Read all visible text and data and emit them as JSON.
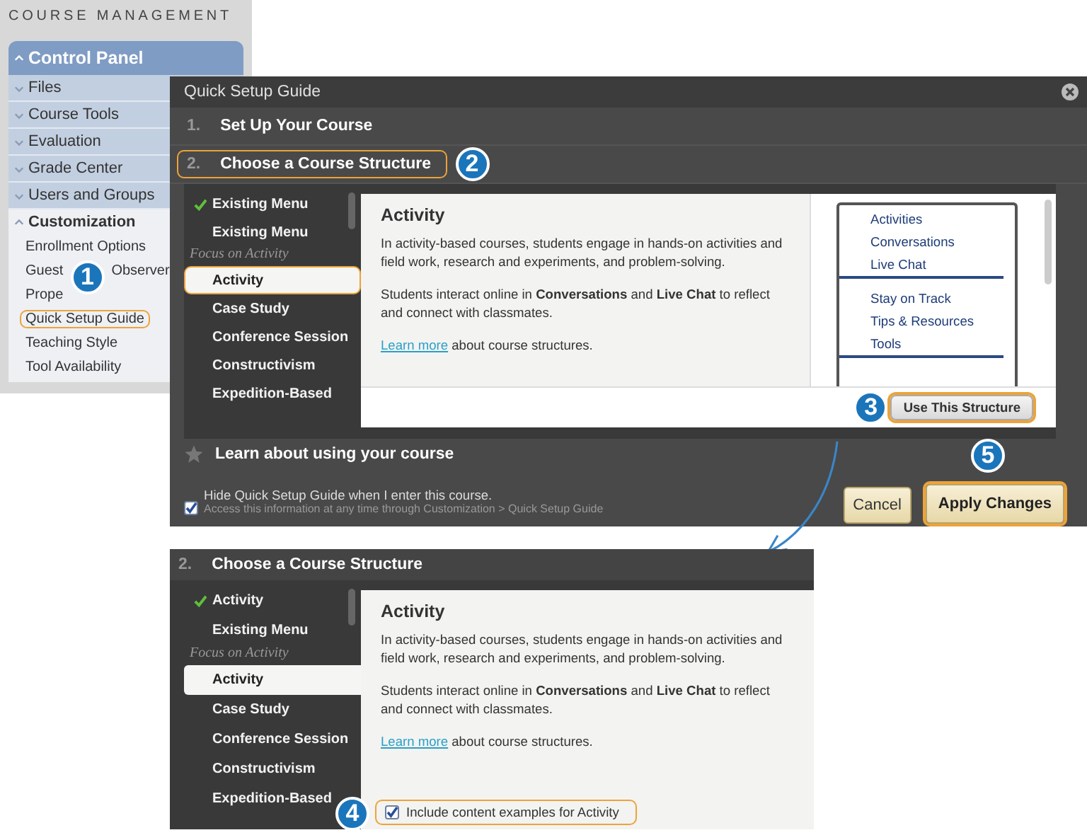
{
  "sidebar": {
    "heading": "COURSE MANAGEMENT",
    "panel_title": "Control Panel",
    "sections": [
      {
        "label": "Files",
        "expanded": false
      },
      {
        "label": "Course Tools",
        "expanded": false
      },
      {
        "label": "Evaluation",
        "expanded": false
      },
      {
        "label": "Grade Center",
        "expanded": false
      },
      {
        "label": "Users and Groups",
        "expanded": false
      },
      {
        "label": "Customization",
        "expanded": true,
        "items": [
          {
            "segments": [
              "Enrollment Options"
            ],
            "highlighted": false
          },
          {
            "segments": [
              "Guest",
              "Observer"
            ],
            "highlighted": false,
            "callout": "1"
          },
          {
            "segments": [
              "Prope"
            ],
            "highlighted": false
          },
          {
            "segments": [
              "Quick Setup Guide"
            ],
            "highlighted": true
          },
          {
            "segments": [
              "Teaching Style"
            ],
            "highlighted": false
          },
          {
            "segments": [
              "Tool Availability"
            ],
            "highlighted": false
          }
        ]
      }
    ]
  },
  "dialog": {
    "title": "Quick Setup Guide",
    "steps": [
      {
        "number": "1.",
        "label": "Set Up Your Course",
        "highlighted": false
      },
      {
        "number": "2.",
        "label": "Choose a Course Structure",
        "highlighted": true,
        "callout": "2"
      }
    ],
    "structure_list": [
      {
        "kind": "item",
        "label": "Existing Menu",
        "checked": true,
        "selected": false,
        "highlighted": false
      },
      {
        "kind": "item",
        "label": "Existing Menu",
        "checked": false,
        "selected": false,
        "highlighted": false
      },
      {
        "kind": "group",
        "label": "Focus on Activity"
      },
      {
        "kind": "item",
        "label": "Activity",
        "checked": false,
        "selected": true,
        "highlighted": true
      },
      {
        "kind": "item",
        "label": "Case Study",
        "checked": false,
        "selected": false,
        "highlighted": false
      },
      {
        "kind": "item",
        "label": "Conference Session",
        "checked": false,
        "selected": false,
        "highlighted": false
      },
      {
        "kind": "item",
        "label": "Constructivism",
        "checked": false,
        "selected": false,
        "highlighted": false
      },
      {
        "kind": "item",
        "label": "Expedition-Based",
        "checked": false,
        "selected": false,
        "highlighted": false
      }
    ],
    "detail": {
      "title": "Activity",
      "paragraphs": [
        "In activity-based courses, students engage in hands-on activities and field work, research and experiments, and problem-solving.",
        "Students interact online in **Conversations** and **Live Chat** to reflect and connect with classmates."
      ],
      "link": "Learn more",
      "link_rest": " about course structures."
    },
    "preview_menu": [
      {
        "label": "Activities",
        "divider_after": false
      },
      {
        "label": "Conversations",
        "divider_after": false
      },
      {
        "label": "Live Chat",
        "divider_after": true
      },
      {
        "label": "Stay on Track",
        "divider_after": false
      },
      {
        "label": "Tips & Resources",
        "divider_after": false
      },
      {
        "label": "Tools",
        "divider_after": true
      }
    ],
    "use_button": {
      "label": "Use This Structure",
      "highlighted": true,
      "callout": "3"
    },
    "learn_step": "Learn about using your course",
    "hide_option": {
      "label": "Hide Quick Setup Guide when I enter this course.",
      "hint": "Access this information at any time through Customization > Quick Setup Guide",
      "checked": true
    },
    "buttons": [
      {
        "label": "Cancel",
        "highlighted": false
      },
      {
        "label": "Apply Changes",
        "highlighted": true,
        "callout": "5"
      }
    ]
  },
  "detail_panel": {
    "step_number": "2.",
    "step_label": "Choose a Course Structure",
    "structure_list": [
      {
        "kind": "item",
        "label": "Activity",
        "checked": true,
        "selected": false,
        "highlighted": false
      },
      {
        "kind": "item",
        "label": "Existing Menu",
        "checked": false,
        "selected": false,
        "highlighted": false
      },
      {
        "kind": "group",
        "label": "Focus on Activity"
      },
      {
        "kind": "item",
        "label": "Activity",
        "checked": false,
        "selected": true,
        "highlighted": false
      },
      {
        "kind": "item",
        "label": "Case Study",
        "checked": false,
        "selected": false,
        "highlighted": false
      },
      {
        "kind": "item",
        "label": "Conference Session",
        "checked": false,
        "selected": false,
        "highlighted": false
      },
      {
        "kind": "item",
        "label": "Constructivism",
        "checked": false,
        "selected": false,
        "highlighted": false
      },
      {
        "kind": "item",
        "label": "Expedition-Based",
        "checked": false,
        "selected": false,
        "highlighted": false
      }
    ],
    "detail": {
      "title": "Activity",
      "paragraphs": [
        "In activity-based courses, students engage in hands-on activities and field work, research and experiments, and problem-solving.",
        "Students interact online in **Conversations** and **Live Chat** to reflect and connect with classmates."
      ],
      "link": "Learn more",
      "link_rest": " about course structures."
    },
    "include_option": {
      "label": "Include content examples for Activity",
      "checked": true,
      "highlighted": true,
      "callout": "4"
    }
  }
}
